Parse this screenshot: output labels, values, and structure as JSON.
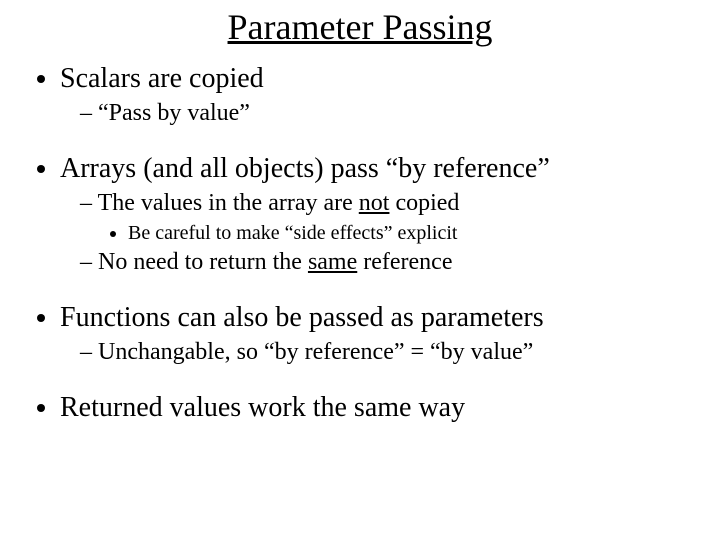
{
  "title": "Parameter Passing",
  "b1": {
    "text": "Scalars are copied",
    "s1": "“Pass by value”"
  },
  "b2": {
    "text": "Arrays (and all objects) pass “by reference”",
    "s1_pre": "The values in the array are ",
    "s1_u": "not",
    "s1_post": " copied",
    "s1a": "Be careful to make “side effects” explicit",
    "s2_pre": "No need to return the ",
    "s2_u": "same",
    "s2_post": " reference"
  },
  "b3": {
    "text": "Functions can also be passed as parameters",
    "s1": "Unchangable, so “by reference” = “by value”"
  },
  "b4": {
    "text": "Returned values work the same way"
  }
}
